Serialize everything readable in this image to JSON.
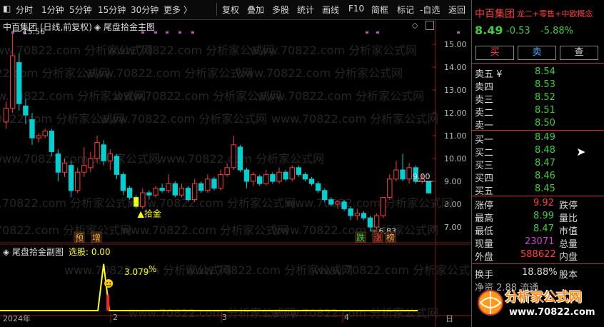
{
  "toolbar": {
    "items": [
      "分时",
      "1分钟",
      "5分钟",
      "15分钟",
      "30分钟",
      "更多 〉",
      "复权",
      "叠加",
      "多股",
      "统计",
      "画线",
      "F10",
      "简框",
      "标记",
      "-自选",
      "返回"
    ]
  },
  "main_chart": {
    "title": "中百集团 (日线,前复权)",
    "indicator": "尾盘拾金主图",
    "high_label": "15.56",
    "low_label": "6.83",
    "cur_label": "9.00",
    "signal_label": "拾金",
    "tags": [
      "预",
      "增",
      "跌",
      "涨",
      "榜"
    ],
    "watermark": "www.70822.com 分析家公式网",
    "price_axis": [
      "15.00",
      "14.00",
      "13.00",
      "12.00",
      "11.00",
      "10.00",
      "9.00",
      "8.00",
      "7.00"
    ]
  },
  "sub_chart": {
    "title": "尾盘拾金副图",
    "select_label": "选股: 0.00",
    "peak_label": "3.079",
    "pct_label": "%",
    "date_labels": [
      "2024年",
      "2",
      "3",
      "4",
      "日"
    ]
  },
  "quote": {
    "name": "中百集团",
    "concepts": "龙二+零售+中欧概念",
    "price": "8.49",
    "change": "-0.53",
    "pct": "-5.88%",
    "buy_label": "买",
    "sell_label": "卖",
    "query_label": "查",
    "asks": [
      {
        "label": "卖五 ¥",
        "price": "8.54"
      },
      {
        "label": "卖四",
        "price": "8.53"
      },
      {
        "label": "卖三",
        "price": "8.52"
      },
      {
        "label": "卖二",
        "price": "8.51"
      },
      {
        "label": "卖一",
        "price": "8.50"
      }
    ],
    "bids": [
      {
        "label": "买一",
        "price": "8.49"
      },
      {
        "label": "买二",
        "price": "8.48"
      },
      {
        "label": "买三",
        "price": "8.47"
      },
      {
        "label": "买四",
        "price": "8.46"
      },
      {
        "label": "买五",
        "price": "8.45"
      }
    ],
    "stats": [
      {
        "label": "涨停",
        "value": "9.92",
        "label2": "跌停"
      },
      {
        "label": "最高",
        "value": "8.99",
        "label2": "量比"
      },
      {
        "label": "最低",
        "value": "8.47",
        "label2": "市值"
      },
      {
        "label": "现量",
        "value": "23071",
        "label2": "总量"
      },
      {
        "label": "外盘",
        "value": "588622",
        "label2": "内盘"
      }
    ],
    "turnover_label": "换手",
    "turnover_value": "18.88%",
    "turnover_label2": "股本",
    "last_row": "净资    2.88 流通",
    "logo_text": "分析家公式网",
    "logo_url": "www.70822.com",
    "colors": {
      "up": "#ff3b3b",
      "down": "#00d0d0",
      "green": "#3ccf3c",
      "yellow": "#ffff00",
      "magenta": "#d040d0"
    }
  },
  "chart_data": {
    "type": "candlestick",
    "title": "中百集团 (日线,前复权)",
    "ylim": [
      6.5,
      15.5
    ],
    "candles": [
      {
        "o": 11.6,
        "c": 12.2,
        "h": 12.5,
        "l": 11.3
      },
      {
        "o": 12.2,
        "c": 14.5,
        "h": 15.56,
        "l": 12.0
      },
      {
        "o": 14.2,
        "c": 12.4,
        "h": 14.6,
        "l": 12.1
      },
      {
        "o": 12.3,
        "c": 11.9,
        "h": 12.6,
        "l": 11.5
      },
      {
        "o": 11.7,
        "c": 10.9,
        "h": 12.0,
        "l": 10.6
      },
      {
        "o": 10.9,
        "c": 11.0,
        "h": 11.1,
        "l": 10.7
      },
      {
        "o": 11.0,
        "c": 11.2,
        "h": 11.3,
        "l": 10.9
      },
      {
        "o": 11.2,
        "c": 10.3,
        "h": 11.3,
        "l": 10.1
      },
      {
        "o": 10.2,
        "c": 9.4,
        "h": 10.4,
        "l": 9.0
      },
      {
        "o": 9.4,
        "c": 9.8,
        "h": 10.0,
        "l": 9.2
      },
      {
        "o": 9.7,
        "c": 8.6,
        "h": 9.9,
        "l": 8.3
      },
      {
        "o": 8.6,
        "c": 9.4,
        "h": 9.6,
        "l": 8.5
      },
      {
        "o": 9.4,
        "c": 9.7,
        "h": 10.5,
        "l": 9.2
      },
      {
        "o": 9.6,
        "c": 10.0,
        "h": 10.3,
        "l": 9.4
      },
      {
        "o": 10.0,
        "c": 10.7,
        "h": 11.0,
        "l": 9.8
      },
      {
        "o": 10.6,
        "c": 9.9,
        "h": 10.8,
        "l": 9.7
      },
      {
        "o": 9.9,
        "c": 10.2,
        "h": 10.4,
        "l": 9.5
      },
      {
        "o": 10.1,
        "c": 9.3,
        "h": 10.2,
        "l": 9.1
      },
      {
        "o": 9.3,
        "c": 8.6,
        "h": 9.4,
        "l": 8.4
      },
      {
        "o": 8.7,
        "c": 8.3,
        "h": 8.8,
        "l": 8.2
      },
      {
        "o": 8.3,
        "c": 7.9,
        "h": 8.4,
        "l": 7.8
      },
      {
        "o": 7.9,
        "c": 8.5,
        "h": 8.7,
        "l": 7.8
      },
      {
        "o": 8.5,
        "c": 8.4,
        "h": 8.6,
        "l": 8.2
      },
      {
        "o": 8.4,
        "c": 8.7,
        "h": 8.8,
        "l": 8.3
      },
      {
        "o": 8.7,
        "c": 8.6,
        "h": 8.9,
        "l": 8.5
      },
      {
        "o": 8.6,
        "c": 8.9,
        "h": 9.3,
        "l": 8.5
      },
      {
        "o": 8.9,
        "c": 8.4,
        "h": 9.0,
        "l": 8.3
      },
      {
        "o": 8.4,
        "c": 8.7,
        "h": 8.9,
        "l": 8.3
      },
      {
        "o": 8.7,
        "c": 8.2,
        "h": 8.8,
        "l": 8.1
      },
      {
        "o": 8.2,
        "c": 8.9,
        "h": 9.1,
        "l": 8.1
      },
      {
        "o": 8.9,
        "c": 8.6,
        "h": 9.0,
        "l": 8.5
      },
      {
        "o": 8.6,
        "c": 9.1,
        "h": 9.3,
        "l": 8.5
      },
      {
        "o": 9.1,
        "c": 8.7,
        "h": 9.2,
        "l": 8.6
      },
      {
        "o": 8.7,
        "c": 9.3,
        "h": 9.5,
        "l": 8.6
      },
      {
        "o": 9.3,
        "c": 9.6,
        "h": 9.8,
        "l": 9.2
      },
      {
        "o": 9.6,
        "c": 10.6,
        "h": 11.0,
        "l": 9.5
      },
      {
        "o": 10.5,
        "c": 9.5,
        "h": 10.6,
        "l": 9.4
      },
      {
        "o": 9.5,
        "c": 9.0,
        "h": 9.6,
        "l": 8.7
      },
      {
        "o": 9.0,
        "c": 9.3,
        "h": 9.4,
        "l": 8.8
      },
      {
        "o": 9.2,
        "c": 8.9,
        "h": 9.3,
        "l": 8.8
      },
      {
        "o": 8.9,
        "c": 9.3,
        "h": 9.5,
        "l": 8.8
      },
      {
        "o": 9.3,
        "c": 9.0,
        "h": 9.4,
        "l": 8.9
      },
      {
        "o": 9.0,
        "c": 9.4,
        "h": 9.6,
        "l": 8.9
      },
      {
        "o": 9.4,
        "c": 9.1,
        "h": 9.5,
        "l": 9.0
      },
      {
        "o": 9.1,
        "c": 9.6,
        "h": 9.7,
        "l": 9.0
      },
      {
        "o": 9.6,
        "c": 9.3,
        "h": 9.7,
        "l": 9.2
      },
      {
        "o": 9.3,
        "c": 9.1,
        "h": 9.4,
        "l": 9.0
      },
      {
        "o": 9.1,
        "c": 8.9,
        "h": 9.2,
        "l": 8.8
      },
      {
        "o": 8.9,
        "c": 8.6,
        "h": 9.0,
        "l": 8.5
      },
      {
        "o": 8.6,
        "c": 8.2,
        "h": 8.7,
        "l": 8.1
      },
      {
        "o": 8.2,
        "c": 8.0,
        "h": 8.3,
        "l": 7.9
      },
      {
        "o": 8.0,
        "c": 8.1,
        "h": 8.2,
        "l": 7.8
      },
      {
        "o": 8.1,
        "c": 7.8,
        "h": 8.2,
        "l": 7.7
      },
      {
        "o": 7.8,
        "c": 7.5,
        "h": 7.9,
        "l": 7.3
      },
      {
        "o": 7.5,
        "c": 7.6,
        "h": 7.8,
        "l": 7.3
      },
      {
        "o": 7.6,
        "c": 7.4,
        "h": 7.7,
        "l": 7.3
      },
      {
        "o": 7.4,
        "c": 7.0,
        "h": 7.5,
        "l": 6.83
      },
      {
        "o": 7.0,
        "c": 7.5,
        "h": 7.6,
        "l": 6.9
      },
      {
        "o": 7.5,
        "c": 8.3,
        "h": 8.3,
        "l": 7.4
      },
      {
        "o": 8.3,
        "c": 9.1,
        "h": 9.3,
        "l": 8.2
      },
      {
        "o": 9.1,
        "c": 9.5,
        "h": 9.9,
        "l": 9.0
      },
      {
        "o": 9.5,
        "c": 9.1,
        "h": 10.2,
        "l": 9.0
      },
      {
        "o": 9.1,
        "c": 9.6,
        "h": 9.8,
        "l": 8.9
      },
      {
        "o": 9.6,
        "c": 9.0,
        "h": 9.7,
        "l": 8.9
      },
      {
        "o": 9.0,
        "c": 9.1,
        "h": 9.3,
        "l": 8.9
      },
      {
        "o": 9.0,
        "c": 8.49,
        "h": 8.99,
        "l": 8.47
      }
    ],
    "sub_series": {
      "name": "尾盘拾金副图",
      "peak_value": 3.079,
      "peak_index": 15
    }
  }
}
